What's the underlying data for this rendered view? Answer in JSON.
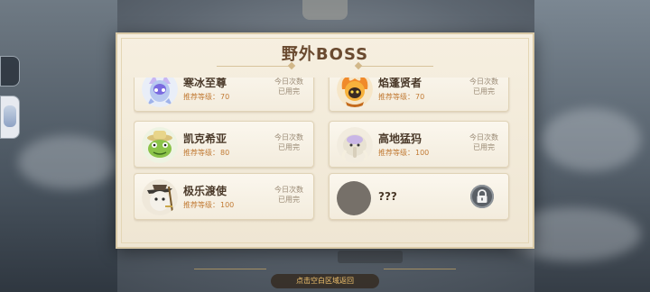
{
  "panel": {
    "title": "野外BOSS"
  },
  "bosses": [
    {
      "name": "寒冰至尊",
      "level_label": "推荐等级：",
      "level": "70",
      "status_line1": "今日次数",
      "status_line2": "已用完",
      "locked": false
    },
    {
      "name": "焰蓬贤者",
      "level_label": "推荐等级：",
      "level": "70",
      "status_line1": "今日次数",
      "status_line2": "已用完",
      "locked": false
    },
    {
      "name": "凯克希亚",
      "level_label": "推荐等级：",
      "level": "80",
      "status_line1": "今日次数",
      "status_line2": "已用完",
      "locked": false
    },
    {
      "name": "高地猛犸",
      "level_label": "推荐等级：",
      "level": "100",
      "status_line1": "今日次数",
      "status_line2": "已用完",
      "locked": false
    },
    {
      "name": "极乐渡使",
      "level_label": "推荐等级：",
      "level": "100",
      "status_line1": "今日次数",
      "status_line2": "已用完",
      "locked": false
    },
    {
      "name": "???",
      "locked": true,
      "icon": "lock-icon"
    }
  ],
  "footer": {
    "hint": "点击空白区域返回"
  },
  "colors": {
    "panel_bg": "#f4ecdb",
    "title": "#6a4a30",
    "level_text": "#c17a34",
    "status_text": "#9a8a75"
  }
}
